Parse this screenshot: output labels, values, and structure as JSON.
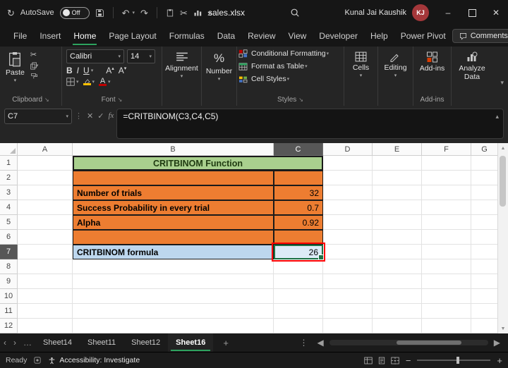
{
  "window": {
    "autosave_label": "AutoSave",
    "autosave_state": "Off",
    "title": "sales.xlsx",
    "user_name": "Kunal Jai Kaushik",
    "user_initials": "KJ"
  },
  "menu": {
    "tabs": [
      "File",
      "Insert",
      "Home",
      "Page Layout",
      "Formulas",
      "Data",
      "Review",
      "View",
      "Developer",
      "Help",
      "Power Pivot"
    ],
    "active_tab": "Home",
    "comments_label": "Comments"
  },
  "ribbon": {
    "paste_label": "Paste",
    "clipboard_group": "Clipboard",
    "font_name": "Calibri",
    "font_size": "14",
    "font_group": "Font",
    "format": {
      "bold": "B",
      "italic": "I",
      "underline": "U",
      "grow": "A",
      "shrink": "A",
      "font_color": "A"
    },
    "alignment_label": "Alignment",
    "number_label": "Number",
    "number_icon": "%",
    "styles": {
      "conditional": "Conditional Formatting",
      "format_table": "Format as Table",
      "cell_styles": "Cell Styles",
      "group": "Styles"
    },
    "cells_label": "Cells",
    "editing_label": "Editing",
    "addins_label": "Add-ins",
    "addins_group": "Add-ins",
    "analyze_label": "Analyze Data"
  },
  "formula_bar": {
    "cell_ref": "C7",
    "fx_label": "fx",
    "formula": "=CRITBINOM(C3,C4,C5)"
  },
  "grid": {
    "col_headers": [
      "A",
      "B",
      "C",
      "D",
      "E",
      "F",
      "G"
    ],
    "row_headers": [
      "1",
      "2",
      "3",
      "4",
      "5",
      "6",
      "7",
      "8",
      "9",
      "10",
      "11",
      "12"
    ],
    "title": "CRITBINOM Function",
    "items": [
      {
        "label": "Number of trials",
        "value": "32"
      },
      {
        "label": "Success Probability in every trial",
        "value": "0.7"
      },
      {
        "label": "Alpha",
        "value": "0.92"
      }
    ],
    "result": {
      "label": "CRITBINOM formula",
      "value": "26"
    },
    "colors": {
      "orange": "#ED7D31",
      "title_green": "#A9D08E",
      "label_blue": "#BDD7EE",
      "result_blue": "#DDEBF7",
      "selection_green": "#1E7145",
      "annotation_red": "#FF0000",
      "tab_accent_green": "#2DA25E",
      "avatar_red": "#A4373A"
    }
  },
  "tabs": {
    "sheets": [
      "Sheet14",
      "Sheet11",
      "Sheet12",
      "Sheet16"
    ],
    "active": "Sheet16"
  },
  "status": {
    "ready": "Ready",
    "accessibility": "Accessibility: Investigate"
  }
}
